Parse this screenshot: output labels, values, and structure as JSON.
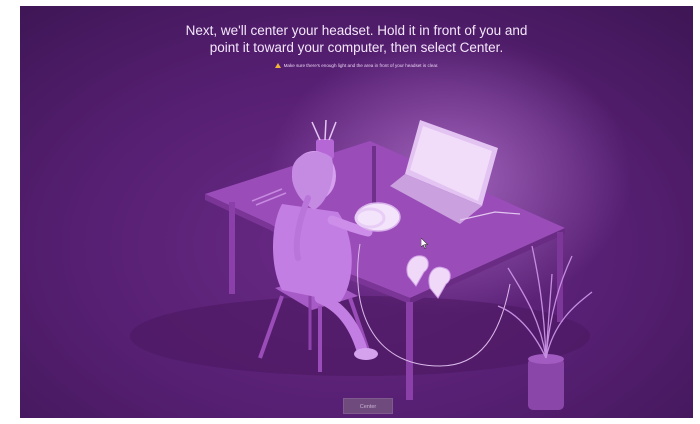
{
  "setup": {
    "instruction_line1": "Next, we'll center your headset. Hold it in front of you and",
    "instruction_line2": "point it toward your computer, then select Center.",
    "warning_text": "Make sure there's enough light and the area in front of your headset is clear.",
    "warning_icon": "warning-triangle-icon",
    "center_button_label": "Center"
  },
  "colors": {
    "background": "#561f72",
    "glow": "#d696f0",
    "warning": "#f0b43a",
    "button": "#6e4a7d"
  }
}
